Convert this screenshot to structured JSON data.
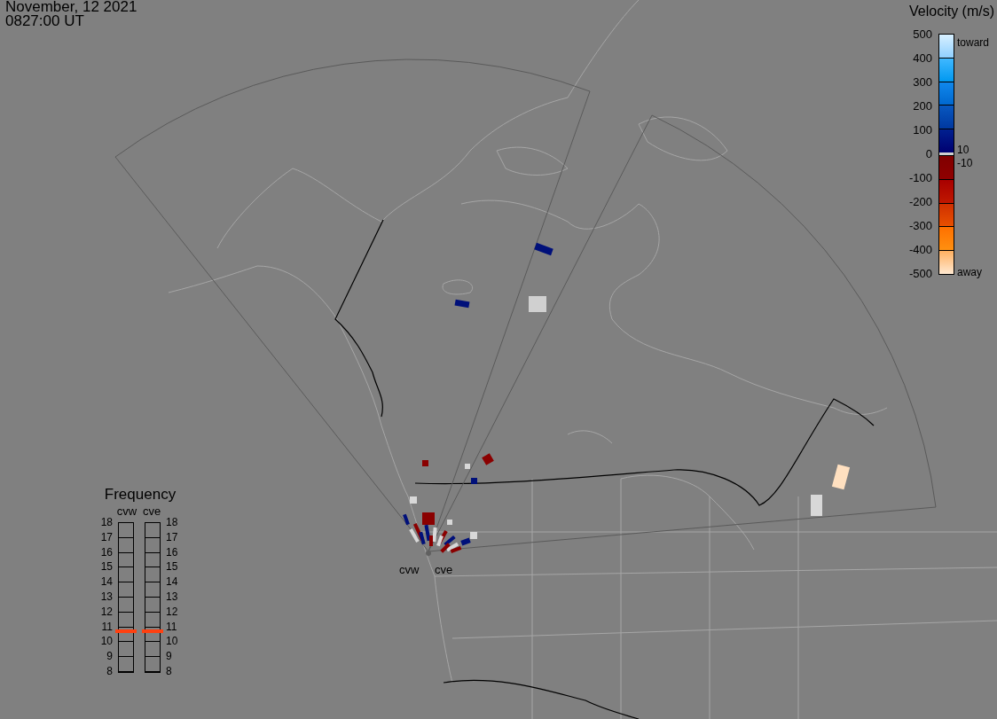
{
  "header": {
    "date": "November, 12 2021",
    "time": "0827:00 UT"
  },
  "velocity_scale": {
    "title": "Velocity (m/s)",
    "ticks": [
      "500",
      "400",
      "300",
      "200",
      "100",
      "0",
      "-100",
      "-200",
      "-300",
      "-400",
      "-500"
    ],
    "toward_label": "toward",
    "upper_threshold": "10",
    "lower_threshold": "-10",
    "away_label": "away"
  },
  "frequency": {
    "title": "Frequency",
    "radars": [
      {
        "name": "cvw",
        "level": 0.275,
        "ticks": [
          "18",
          "17",
          "16",
          "15",
          "14",
          "13",
          "12",
          "11",
          "10",
          "9",
          "8"
        ]
      },
      {
        "name": "cve",
        "level": 0.275,
        "ticks": [
          "18",
          "17",
          "16",
          "15",
          "14",
          "13",
          "12",
          "11",
          "10",
          "9",
          "8"
        ]
      }
    ]
  },
  "map": {
    "sites": [
      "cvw",
      "cve"
    ]
  }
}
